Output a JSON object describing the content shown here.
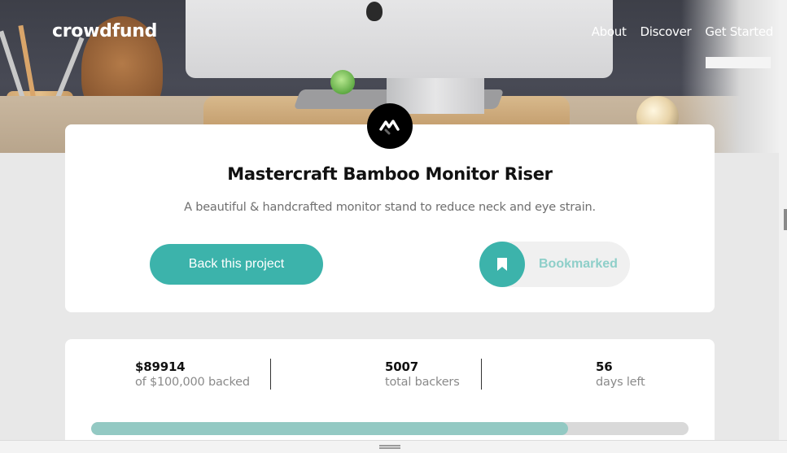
{
  "header": {
    "brand": "crowdfund",
    "nav": [
      {
        "label": "About"
      },
      {
        "label": "Discover"
      },
      {
        "label": "Get Started"
      }
    ]
  },
  "project": {
    "logo_icon": "mastercraft-logo-icon",
    "title": "Mastercraft Bamboo Monitor Riser",
    "description": "A beautiful & handcrafted monitor stand to reduce neck and eye strain.",
    "back_label": "Back this project",
    "bookmark_label": "Bookmarked",
    "bookmark_icon": "bookmark-icon"
  },
  "stats": {
    "backed": {
      "value": "$89914",
      "caption": "of $100,000 backed"
    },
    "backers": {
      "value": "5007",
      "caption": "total backers"
    },
    "days": {
      "value": "56",
      "caption": "days left"
    },
    "progress_fraction": 0.799
  },
  "colors": {
    "accent": "#3cb3ab",
    "accent_light": "#93c9c3",
    "bookmark_text": "#8ecfc9",
    "page_bg": "#e8e8e8"
  }
}
